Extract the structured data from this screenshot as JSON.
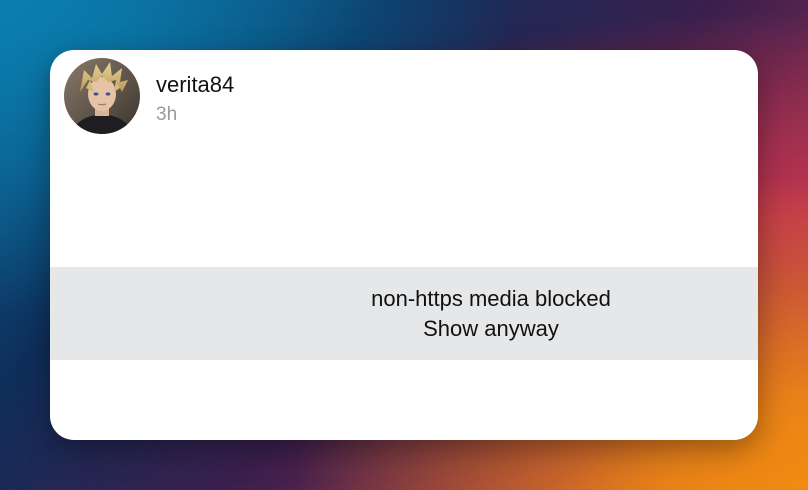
{
  "post": {
    "username": "verita84",
    "time": "3h",
    "avatar_icon": "user-avatar"
  },
  "media_notice": {
    "message": "non-https media blocked",
    "action_label": "Show anyway"
  },
  "colors": {
    "card_background": "#ffffff",
    "notice_background": "#e6e7e9",
    "username_text": "#111111",
    "time_text": "#9a9a9a"
  }
}
